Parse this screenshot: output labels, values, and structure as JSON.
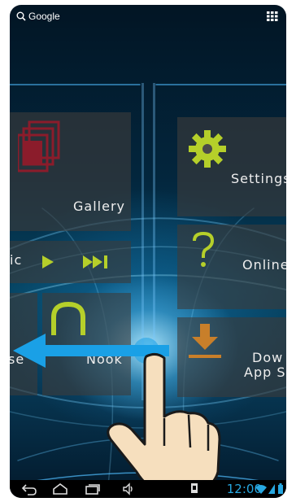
{
  "topbar": {
    "search_label": "Google",
    "search_icon": "search-icon",
    "apps_icon": "all-apps-icon"
  },
  "tiles": {
    "gallery": {
      "label": "Gallery",
      "icon": "gallery-icon"
    },
    "music": {
      "label_fragment": "ic",
      "icons": [
        "play-icon",
        "skip-next-icon"
      ]
    },
    "nook": {
      "label": "Nook",
      "icon": "nook-icon"
    },
    "left_fragment": {
      "label": "se"
    },
    "settings": {
      "label": "Settings",
      "icon": "gear-icon"
    },
    "online": {
      "label": "Online",
      "icon": "question-icon"
    },
    "download": {
      "label_line1": "Dow",
      "label_line2": "App S",
      "icon": "download-icon"
    }
  },
  "gesture": {
    "arrow_icon": "swipe-left-arrow-icon",
    "hand_icon": "pointing-hand-icon"
  },
  "navbar": {
    "back_icon": "back-icon",
    "home_icon": "home-icon",
    "recent_icon": "recent-apps-icon",
    "volume_icon": "volume-icon",
    "time": "12:00",
    "colors": {
      "clock": "#27a7e0"
    }
  },
  "colors": {
    "gallery_icon": "#8b1c2b",
    "tile_accent": "#b5cf2a",
    "arrow": "#1aa0e6"
  }
}
